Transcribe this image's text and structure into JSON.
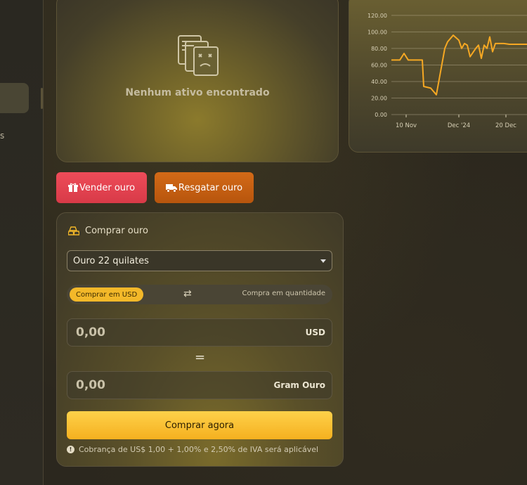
{
  "sidebar": {
    "partial_label": "s"
  },
  "portfolio": {
    "empty_text": "Nenhum ativo encontrado",
    "empty_icon": "no-documents-icon"
  },
  "chart_data": {
    "type": "line",
    "x_ticks": [
      "10 Nov",
      "Dec '24",
      "20 Dec"
    ],
    "y_ticks": [
      "0.00",
      "20.00",
      "40.00",
      "60.00",
      "80.00",
      "100.00",
      "120.00"
    ],
    "ylim": [
      0,
      125
    ],
    "line_color": "#f6a823",
    "series": [
      {
        "x": [
          0,
          6,
          9,
          12,
          14,
          17,
          22,
          23,
          28,
          32,
          38,
          40,
          42,
          44,
          46,
          48,
          50,
          52,
          54,
          56,
          60,
          62,
          64,
          66,
          68,
          70,
          72,
          74,
          76,
          80,
          84,
          86,
          88,
          90,
          92,
          94,
          96,
          98,
          100
        ],
        "values": [
          66,
          66,
          74,
          66,
          66,
          66,
          66,
          34,
          32,
          24,
          80,
          88,
          92,
          96,
          93,
          90,
          80,
          86,
          84,
          70,
          80,
          84,
          68,
          84,
          80,
          94,
          76,
          86,
          86,
          86,
          85,
          85,
          85,
          85,
          85,
          85,
          85,
          85,
          85
        ]
      }
    ]
  },
  "actions": {
    "sell_label": "Vender ouro",
    "redeem_label": "Resgatar ouro",
    "sell_icon": "gift-icon",
    "redeem_icon": "truck-icon",
    "sell_color": "#e94452",
    "redeem_color": "#c75f12"
  },
  "buy": {
    "title": "Comprar ouro",
    "select_value": "Ouro 22 quilates",
    "toggle_active": "Comprar em USD",
    "toggle_inactive": "Compra em quantidade",
    "amount_value": "0,00",
    "amount_unit": "USD",
    "equals": "=",
    "gram_value": "0,00",
    "gram_unit": "Gram Ouro",
    "submit_label": "Comprar agora",
    "note": "Cobrança de US$ 1,00 + 1,00% e 2,50% de IVA será aplicável",
    "accent": "#f5b52a"
  }
}
